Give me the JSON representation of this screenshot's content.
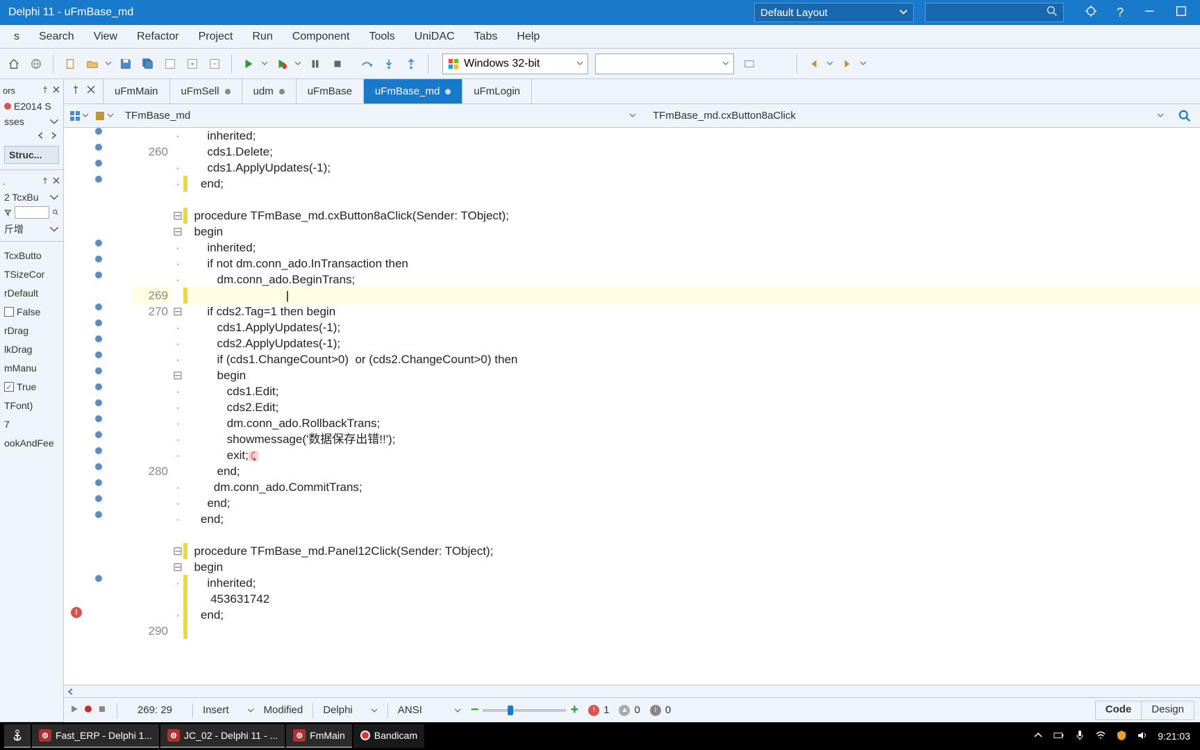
{
  "title": "Delphi 11 - uFmBase_md",
  "layout_combo": "Default Layout",
  "menu": [
    "s",
    "Search",
    "View",
    "Refactor",
    "Project",
    "Run",
    "Component",
    "Tools",
    "UniDAC",
    "Tabs",
    "Help"
  ],
  "platform": "Windows 32-bit",
  "tabs": [
    {
      "label": "uFmMain",
      "dirty": false
    },
    {
      "label": "uFmSell",
      "dirty": true
    },
    {
      "label": "udm",
      "dirty": true
    },
    {
      "label": "uFmBase",
      "dirty": false
    },
    {
      "label": "uFmBase_md",
      "dirty": true,
      "active": true
    },
    {
      "label": "uFmLogin",
      "dirty": false
    }
  ],
  "nav": {
    "class": "TFmBase_md",
    "method": "TFmBase_md.cxButton8aClick"
  },
  "left": {
    "row0": "ors",
    "row1": "E2014 S",
    "row2": "sses",
    "structure": "Struc...",
    "row3": "2  TcxBu",
    "row_new": "斤增",
    "items": [
      "TcxButto",
      "TSizeCor",
      "rDefault",
      "False",
      "rDrag",
      "lkDrag",
      "mManu",
      "True",
      "TFont)",
      "7",
      "ookAndFee"
    ]
  },
  "code": [
    {
      "bp": "dot",
      "ln": "",
      "fold": "·",
      "mod": "",
      "txt": "    <kw>inherited</kw>;"
    },
    {
      "bp": "dot",
      "ln": "260",
      "fold": "",
      "mod": "",
      "txt": "    cds1.Delete;"
    },
    {
      "bp": "dot",
      "ln": "",
      "fold": "·",
      "mod": "",
      "txt": "    cds1.ApplyUpdates(-1);"
    },
    {
      "bp": "dot",
      "ln": "",
      "fold": "·",
      "mod": "y",
      "txt": "  <kw>end</kw>;"
    },
    {
      "bp": "",
      "ln": "",
      "fold": "",
      "mod": "",
      "txt": ""
    },
    {
      "bp": "",
      "ln": "",
      "fold": "-",
      "mod": "y",
      "txt": "<kw>procedure</kw> TFmBase_md.cxButton8aClick(Sender: TObject);"
    },
    {
      "bp": "",
      "ln": "",
      "fold": "-",
      "mod": "",
      "txt": "<kw>begin</kw>"
    },
    {
      "bp": "dot",
      "ln": "",
      "fold": "·",
      "mod": "",
      "txt": "    <kw>inherited</kw>;"
    },
    {
      "bp": "dot",
      "ln": "",
      "fold": "·",
      "mod": "",
      "txt": "    <kw>if</kw> <kw>not</kw> dm.conn_ado.InTransaction <kw>then</kw>"
    },
    {
      "bp": "dot",
      "ln": "",
      "fold": "·",
      "mod": "",
      "txt": "       dm.conn_ado.BeginTrans;"
    },
    {
      "bp": "",
      "ln": "269",
      "fold": "",
      "mod": "y",
      "hl": true,
      "caret": true,
      "txt": "                            "
    },
    {
      "bp": "dot",
      "ln": "270",
      "fold": "-",
      "mod": "",
      "txt": "    <kw>if</kw> cds2.Tag=1 <kw>then</kw> <kw>begin</kw>"
    },
    {
      "bp": "dot",
      "ln": "",
      "fold": "·",
      "mod": "",
      "txt": "       cds1.ApplyUpdates(-1);"
    },
    {
      "bp": "dot",
      "ln": "",
      "fold": "·",
      "mod": "",
      "txt": "       cds2.ApplyUpdates(-1);"
    },
    {
      "bp": "dot",
      "ln": "",
      "fold": "·",
      "mod": "",
      "txt": "       <kw>if</kw> (cds1.ChangeCount>0)  <kw>or</kw> (cds2.ChangeCount>0) <kw>then</kw>"
    },
    {
      "bp": "dot",
      "ln": "",
      "fold": "-",
      "mod": "",
      "txt": "       <kw>begin</kw>"
    },
    {
      "bp": "dot",
      "ln": "",
      "fold": "·",
      "mod": "",
      "txt": "          cds1.Edit;"
    },
    {
      "bp": "dot",
      "ln": "",
      "fold": "·",
      "mod": "",
      "txt": "          cds2.Edit;"
    },
    {
      "bp": "dot",
      "ln": "",
      "fold": "·",
      "mod": "",
      "txt": "          dm.conn_ado.RollbackTrans;"
    },
    {
      "bp": "dot",
      "ln": "",
      "fold": "·",
      "mod": "",
      "txt": "          showmessage(<str>'数据保存出错!!'</str>);"
    },
    {
      "bp": "dot",
      "ln": "",
      "fold": "·",
      "mod": "",
      "txt": "          exit;<span class='hint'>⤹</span>"
    },
    {
      "bp": "dot",
      "ln": "280",
      "fold": "",
      "mod": "",
      "txt": "       <kw>end</kw>;"
    },
    {
      "bp": "dot",
      "ln": "",
      "fold": "·",
      "mod": "",
      "txt": "      dm.conn_ado.CommitTrans;"
    },
    {
      "bp": "dot",
      "ln": "",
      "fold": "·",
      "mod": "",
      "txt": "    <kw>end</kw>;"
    },
    {
      "bp": "dot",
      "ln": "",
      "fold": "·",
      "mod": "",
      "txt": "  <kw>end</kw>;"
    },
    {
      "bp": "",
      "ln": "",
      "fold": "",
      "mod": "",
      "txt": ""
    },
    {
      "bp": "",
      "ln": "",
      "fold": "-",
      "mod": "y",
      "txt": "<kw>procedure</kw> TFmBase_md.Panel12Click(Sender: TObject);"
    },
    {
      "bp": "",
      "ln": "",
      "fold": "-",
      "mod": "",
      "txt": "<kw>begin</kw>"
    },
    {
      "bp": "dot",
      "ln": "",
      "fold": "·",
      "mod": "y",
      "txt": "    <kw>inherited</kw>;"
    },
    {
      "bp": "",
      "ln": "",
      "fold": "",
      "mod": "y",
      "txt": "     <num>453631742</num>"
    },
    {
      "bp": "err",
      "ln": "",
      "fold": "·",
      "mod": "y",
      "txt": "  <kw>end</kw>;"
    },
    {
      "bp": "",
      "ln": "290",
      "fold": "",
      "mod": "y",
      "txt": ""
    }
  ],
  "status": {
    "pos": "269: 29",
    "ins": "Insert",
    "modified": "Modified",
    "lang": "Delphi",
    "enc": "ANSI",
    "err": "1",
    "warn": "0",
    "info": "0",
    "code_tab": "Code",
    "design_tab": "Design"
  },
  "taskbar": {
    "items": [
      {
        "label": "",
        "icon": "anchor",
        "bg": "#3a6ea5"
      },
      {
        "label": "Fast_ERP - Delphi 1...",
        "icon": "D",
        "bg": "#b03030"
      },
      {
        "label": "JC_02 - Delphi 11 - ...",
        "icon": "D",
        "bg": "#b03030"
      },
      {
        "label": "FmMain",
        "icon": "D",
        "bg": "#b03030"
      },
      {
        "label": "Bandicam",
        "icon": "rec",
        "bg": "#000"
      }
    ],
    "time": "9:21:03"
  }
}
